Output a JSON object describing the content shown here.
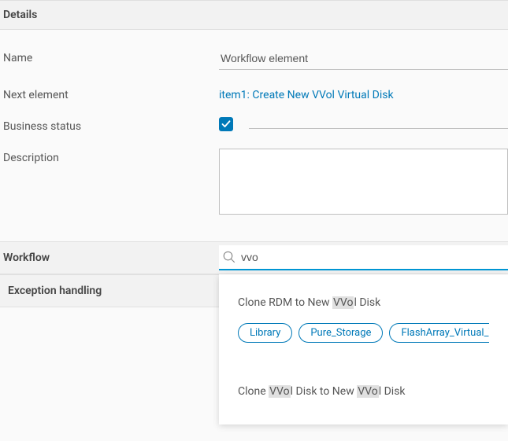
{
  "sections": {
    "details": "Details",
    "workflow": "Workflow",
    "exception": "Exception handling"
  },
  "form": {
    "name_label": "Name",
    "name_value": "Workflow element",
    "next_label": "Next element",
    "next_value": "item1: Create New VVol Virtual Disk",
    "status_label": "Business status",
    "status_checked": true,
    "desc_label": "Description",
    "desc_value": ""
  },
  "search": {
    "value": "vvo"
  },
  "results": [
    {
      "title_parts": [
        "Clone RDM to New ",
        "VVo",
        "l Disk"
      ],
      "tags": [
        "Library",
        "Pure_Storage",
        "FlashArray_Virtual_Volume"
      ]
    },
    {
      "title_parts": [
        "Clone ",
        "VVo",
        "l Disk to New ",
        "VVo",
        "l Disk"
      ],
      "tags": []
    }
  ]
}
